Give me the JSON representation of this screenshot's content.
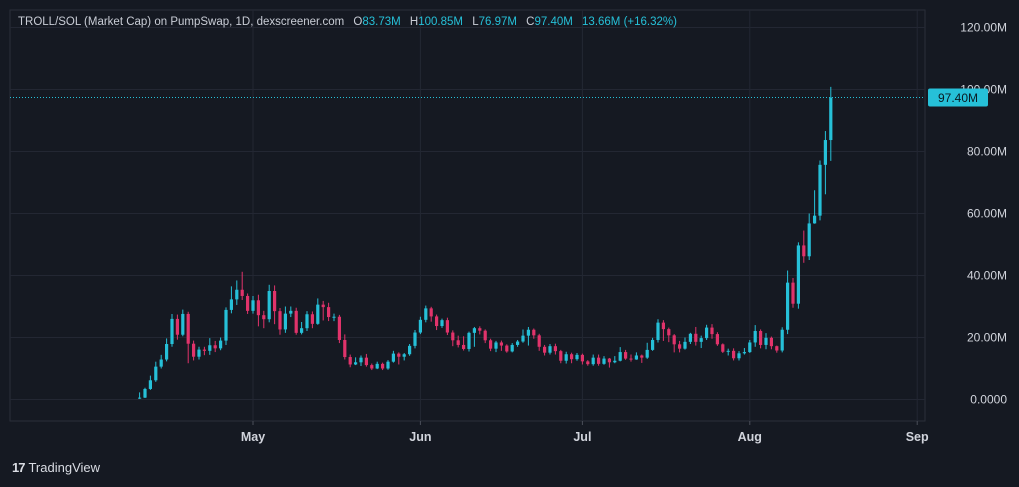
{
  "legend": {
    "pair": "TROLL/SOL (Market Cap) on PumpSwap, 1D, dexscreener.com",
    "o_label": "O",
    "o_value": "83.73M",
    "h_label": "H",
    "h_value": "100.85M",
    "l_label": "L",
    "l_value": "76.97M",
    "c_label": "C",
    "c_value": "97.40M",
    "change": "13.66M (+16.32%)"
  },
  "footer": {
    "logo": "17",
    "brand": "TradingView"
  },
  "colors": {
    "up": "#26c0d8",
    "down": "#e1336b",
    "bg": "#151922",
    "grid": "#232733",
    "text": "#d1d4dc",
    "price_tag": "#26c0d8"
  },
  "chart_data": {
    "type": "candlestick",
    "title": "TROLL/SOL (Market Cap) on PumpSwap, 1D, dexscreener.com",
    "y_unit": "M",
    "ylim": [
      -4,
      122
    ],
    "y_ticks": [
      0,
      20,
      40,
      60,
      80,
      100,
      120
    ],
    "y_tick_labels": [
      "0.0000",
      "20.00M",
      "40.00M",
      "60.00M",
      "80.00M",
      "100.00M",
      "120.00M"
    ],
    "x_ticks": [
      {
        "label": "May",
        "day": 30
      },
      {
        "label": "Jun",
        "day": 61
      },
      {
        "label": "Jul",
        "day": 91
      },
      {
        "label": "Aug",
        "day": 122
      },
      {
        "label": "Sep",
        "day": 153
      }
    ],
    "x_range_days": [
      -16,
      169
    ],
    "last_price": 97.4,
    "last_price_label": "97.40M",
    "candles": [
      [
        9,
        0.5,
        0.6,
        2.3,
        0.2
      ],
      [
        10,
        0.6,
        3.4,
        3.8,
        0.5
      ],
      [
        11,
        3.4,
        6.2,
        7.7,
        3.1
      ],
      [
        12,
        6.2,
        10.6,
        12.2,
        5.7
      ],
      [
        13,
        10.6,
        12.9,
        14.4,
        10.0
      ],
      [
        14,
        12.9,
        17.9,
        19.7,
        12.3
      ],
      [
        15,
        17.9,
        26.0,
        27.6,
        17.0
      ],
      [
        16,
        26.0,
        20.9,
        27.4,
        19.3
      ],
      [
        17,
        20.9,
        27.6,
        29.0,
        20.4
      ],
      [
        18,
        27.6,
        18.0,
        28.3,
        11.7
      ],
      [
        19,
        18.0,
        13.8,
        19.0,
        12.6
      ],
      [
        20,
        13.8,
        16.1,
        17.0,
        12.9
      ],
      [
        21,
        16.1,
        15.7,
        17.0,
        14.3
      ],
      [
        22,
        15.7,
        17.5,
        19.8,
        14.4
      ],
      [
        23,
        17.5,
        16.5,
        18.9,
        15.3
      ],
      [
        24,
        16.5,
        19.0,
        20.0,
        15.9
      ],
      [
        25,
        19.0,
        28.9,
        29.7,
        17.6
      ],
      [
        26,
        28.9,
        32.3,
        36.5,
        27.8
      ],
      [
        27,
        32.3,
        35.4,
        38.4,
        30.5
      ],
      [
        28,
        35.4,
        33.4,
        41.2,
        32.1
      ],
      [
        29,
        33.4,
        28.6,
        34.2,
        27.6
      ],
      [
        30,
        28.6,
        32.0,
        33.4,
        27.7
      ],
      [
        31,
        32.0,
        27.2,
        33.8,
        23.6
      ],
      [
        32,
        27.2,
        25.9,
        28.6,
        23.0
      ],
      [
        33,
        25.9,
        35.0,
        37.0,
        24.9
      ],
      [
        34,
        35.0,
        28.5,
        36.8,
        24.3
      ],
      [
        35,
        28.5,
        22.6,
        29.5,
        20.9
      ],
      [
        36,
        22.6,
        27.7,
        30.0,
        21.5
      ],
      [
        37,
        27.7,
        28.6,
        30.0,
        26.6
      ],
      [
        38,
        28.6,
        21.5,
        29.6,
        20.9
      ],
      [
        39,
        21.5,
        23.0,
        25.0,
        21.0
      ],
      [
        40,
        23.0,
        27.5,
        28.5,
        22.1
      ],
      [
        41,
        27.5,
        24.4,
        28.4,
        23.0
      ],
      [
        42,
        24.4,
        30.6,
        32.6,
        24.1
      ],
      [
        43,
        30.6,
        29.8,
        31.8,
        25.5
      ],
      [
        44,
        29.8,
        26.6,
        31.2,
        25.3
      ],
      [
        45,
        26.6,
        26.7,
        27.7,
        25.3
      ],
      [
        46,
        26.7,
        19.2,
        27.3,
        18.2
      ],
      [
        47,
        19.2,
        13.7,
        21.0,
        12.9
      ],
      [
        48,
        13.7,
        11.3,
        14.5,
        10.4
      ],
      [
        49,
        11.3,
        12.0,
        13.6,
        11.1
      ],
      [
        50,
        12.0,
        13.5,
        14.2,
        10.8
      ],
      [
        51,
        13.5,
        11.1,
        14.7,
        10.6
      ],
      [
        52,
        11.1,
        10.0,
        11.6,
        9.5
      ],
      [
        53,
        10.0,
        11.5,
        12.2,
        9.8
      ],
      [
        54,
        11.5,
        10.0,
        11.9,
        9.5
      ],
      [
        55,
        10.0,
        12.2,
        12.7,
        9.6
      ],
      [
        56,
        12.2,
        14.8,
        15.7,
        11.9
      ],
      [
        57,
        14.8,
        13.8,
        15.2,
        11.3
      ],
      [
        58,
        13.8,
        14.6,
        15.0,
        12.6
      ],
      [
        59,
        14.6,
        17.3,
        17.9,
        14.1
      ],
      [
        60,
        17.3,
        21.6,
        22.4,
        16.5
      ],
      [
        61,
        21.6,
        25.7,
        26.7,
        21.1
      ],
      [
        62,
        25.7,
        29.4,
        30.3,
        24.9
      ],
      [
        63,
        29.4,
        26.8,
        29.9,
        25.1
      ],
      [
        64,
        26.8,
        23.7,
        27.4,
        22.4
      ],
      [
        65,
        23.7,
        25.6,
        26.1,
        23.1
      ],
      [
        66,
        25.6,
        21.6,
        26.4,
        20.8
      ],
      [
        67,
        21.6,
        19.1,
        22.3,
        17.2
      ],
      [
        68,
        19.1,
        17.6,
        20.6,
        16.8
      ],
      [
        69,
        17.6,
        16.3,
        20.4,
        15.8
      ],
      [
        70,
        16.3,
        21.5,
        21.9,
        15.5
      ],
      [
        71,
        21.5,
        23.0,
        23.4,
        17.0
      ],
      [
        72,
        23.0,
        22.2,
        23.6,
        21.0
      ],
      [
        73,
        22.2,
        19.1,
        22.6,
        18.2
      ],
      [
        74,
        19.1,
        16.4,
        19.6,
        15.6
      ],
      [
        75,
        16.4,
        18.4,
        18.9,
        15.3
      ],
      [
        76,
        18.4,
        17.4,
        19.0,
        15.7
      ],
      [
        77,
        17.4,
        15.5,
        17.8,
        15.1
      ],
      [
        78,
        15.5,
        17.6,
        18.2,
        15.2
      ],
      [
        79,
        17.6,
        18.7,
        19.2,
        17.0
      ],
      [
        80,
        18.7,
        20.6,
        22.6,
        18.3
      ],
      [
        81,
        20.6,
        22.5,
        23.4,
        17.4
      ],
      [
        82,
        22.5,
        20.7,
        22.9,
        19.6
      ],
      [
        83,
        20.7,
        17.0,
        21.2,
        15.7
      ],
      [
        84,
        17.0,
        15.1,
        17.6,
        14.2
      ],
      [
        85,
        15.1,
        17.2,
        17.9,
        14.5
      ],
      [
        86,
        17.2,
        15.6,
        18.0,
        14.5
      ],
      [
        87,
        15.6,
        12.5,
        16.0,
        11.7
      ],
      [
        88,
        12.5,
        14.6,
        15.4,
        11.6
      ],
      [
        89,
        14.6,
        13.0,
        15.1,
        11.7
      ],
      [
        90,
        13.0,
        14.4,
        15.0,
        12.5
      ],
      [
        91,
        14.4,
        12.3,
        14.8,
        11.3
      ],
      [
        92,
        12.3,
        11.4,
        12.7,
        10.9
      ],
      [
        93,
        11.4,
        13.5,
        14.5,
        10.9
      ],
      [
        94,
        13.5,
        11.5,
        14.5,
        10.9
      ],
      [
        95,
        11.5,
        13.2,
        14.0,
        11.2
      ],
      [
        96,
        13.2,
        12.0,
        13.4,
        10.3
      ],
      [
        97,
        12.0,
        12.5,
        14.0,
        11.7
      ],
      [
        98,
        12.5,
        15.3,
        16.9,
        12.3
      ],
      [
        99,
        15.3,
        13.2,
        16.0,
        12.8
      ],
      [
        100,
        13.2,
        12.9,
        14.5,
        12.2
      ],
      [
        101,
        12.9,
        14.2,
        15.2,
        12.8
      ],
      [
        102,
        14.2,
        13.5,
        14.5,
        11.8
      ],
      [
        103,
        13.5,
        16.0,
        18.3,
        13.1
      ],
      [
        104,
        16.0,
        19.2,
        19.9,
        15.7
      ],
      [
        105,
        19.2,
        24.8,
        25.9,
        18.4
      ],
      [
        106,
        24.8,
        22.7,
        25.6,
        18.9
      ],
      [
        107,
        22.7,
        20.7,
        23.2,
        18.5
      ],
      [
        108,
        20.7,
        17.8,
        21.1,
        15.2
      ],
      [
        109,
        17.8,
        16.4,
        18.9,
        15.2
      ],
      [
        110,
        16.4,
        18.6,
        20.0,
        16.1
      ],
      [
        111,
        18.6,
        21.2,
        21.5,
        17.9
      ],
      [
        112,
        21.2,
        18.6,
        23.4,
        17.4
      ],
      [
        113,
        18.6,
        19.8,
        20.6,
        16.6
      ],
      [
        114,
        19.8,
        23.2,
        24.1,
        19.2
      ],
      [
        115,
        23.2,
        21.1,
        24.3,
        19.6
      ],
      [
        116,
        21.1,
        17.8,
        21.7,
        17.3
      ],
      [
        117,
        17.8,
        15.4,
        18.1,
        15.0
      ],
      [
        118,
        15.4,
        15.7,
        16.4,
        14.2
      ],
      [
        119,
        15.7,
        13.3,
        16.5,
        12.6
      ],
      [
        120,
        13.3,
        14.9,
        15.6,
        12.6
      ],
      [
        121,
        14.9,
        15.3,
        16.6,
        14.5
      ],
      [
        122,
        15.3,
        18.4,
        19.2,
        15.0
      ],
      [
        123,
        18.4,
        22.1,
        24.0,
        17.0
      ],
      [
        124,
        22.1,
        17.6,
        22.6,
        16.5
      ],
      [
        125,
        17.6,
        19.9,
        21.4,
        16.2
      ],
      [
        126,
        19.9,
        17.2,
        20.3,
        16.2
      ],
      [
        127,
        17.2,
        15.8,
        17.4,
        15.1
      ],
      [
        128,
        15.8,
        22.5,
        23.3,
        15.2
      ],
      [
        129,
        22.5,
        37.7,
        41.6,
        21.1
      ],
      [
        130,
        37.7,
        30.9,
        39.2,
        29.6
      ],
      [
        131,
        30.9,
        49.7,
        50.7,
        29.3
      ],
      [
        132,
        49.7,
        46.2,
        54.5,
        44.1
      ],
      [
        133,
        46.2,
        56.8,
        60.0,
        45.0
      ],
      [
        134,
        56.8,
        59.3,
        67.5,
        56.7
      ],
      [
        135,
        59.3,
        75.7,
        77.1,
        57.8
      ],
      [
        136,
        75.7,
        83.7,
        86.6,
        66.2
      ],
      [
        137,
        83.7,
        97.4,
        100.85,
        76.97
      ]
    ]
  }
}
